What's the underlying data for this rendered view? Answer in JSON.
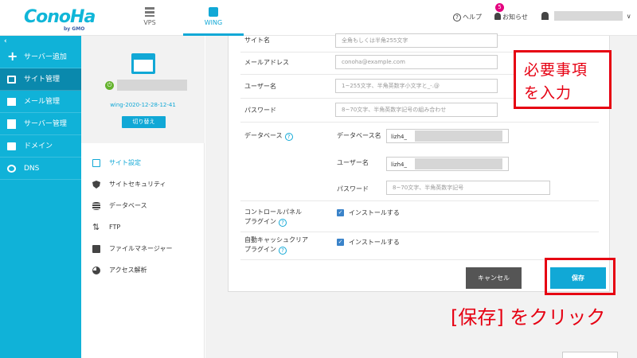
{
  "header": {
    "logo": "ConoHa",
    "logo_sub": "by GMO",
    "tabs": [
      {
        "label": "VPS",
        "icon": "server-icon"
      },
      {
        "label": "WING",
        "icon": "wing-icon"
      }
    ],
    "help_label": "ヘルプ",
    "notice_label": "お知らせ",
    "notice_count": "5",
    "user_caret": "∨"
  },
  "sidebar": {
    "collapse": "‹",
    "items": [
      {
        "label": "サーバー追加",
        "icon": "plus-icon"
      },
      {
        "label": "サイト管理",
        "icon": "site-icon"
      },
      {
        "label": "メール管理",
        "icon": "mail-icon"
      },
      {
        "label": "サーバー管理",
        "icon": "server-manage-icon"
      },
      {
        "label": "ドメイン",
        "icon": "domain-icon"
      },
      {
        "label": "DNS",
        "icon": "globe-icon"
      }
    ]
  },
  "site_panel": {
    "site_code": "wing-2020-12-28-12-41",
    "switch_label": "切り替え",
    "menu": [
      {
        "label": "サイト設定"
      },
      {
        "label": "サイトセキュリティ"
      },
      {
        "label": "データベース"
      },
      {
        "label": "FTP"
      },
      {
        "label": "ファイルマネージャー"
      },
      {
        "label": "アクセス解析"
      }
    ]
  },
  "form": {
    "site_name_label": "サイト名",
    "site_name_placeholder": "全角もしくは半角255文字",
    "email_label": "メールアドレス",
    "email_placeholder": "conoha@example.com",
    "username_label": "ユーザー名",
    "username_placeholder": "1~255文字、半角英数字小文字と_-.@",
    "password_label": "パスワード",
    "password_placeholder": "8~70文字、半角英数字記号の組み合わせ",
    "database_label": "データベース",
    "db_name_label": "データベース名",
    "db_name_prefix": "lizh4_",
    "db_user_label": "ユーザー名",
    "db_user_prefix": "lizh4_",
    "db_password_label": "パスワード",
    "db_password_placeholder": "8~70文字、半角英数字記号",
    "control_panel_label_1": "コントロールパネル",
    "control_panel_label_2": "プラグイン",
    "control_panel_install": "インストールする",
    "cache_label_1": "自動キャッシュクリア",
    "cache_label_2": "プラグイン",
    "cache_install": "インストールする",
    "cancel_label": "キャンセル",
    "save_label": "保存"
  },
  "annotations": {
    "note_line_1": "必要事項",
    "note_line_2": "を入力",
    "save_hint": "[保存] をクリック",
    "color": "#e60012"
  }
}
